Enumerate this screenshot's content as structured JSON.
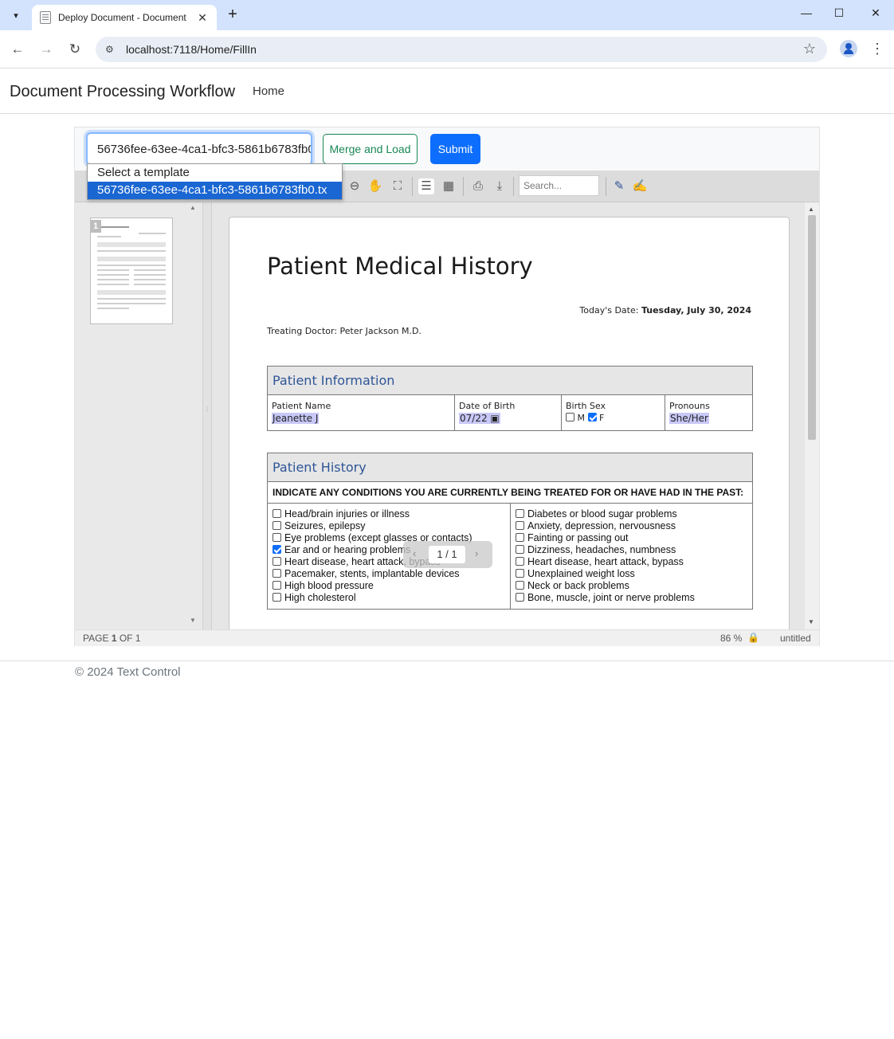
{
  "browser": {
    "tab_title": "Deploy Document - Document",
    "url": "localhost:7118/Home/FillIn"
  },
  "app": {
    "brand": "Document Processing Workflow",
    "nav_home": "Home",
    "footer": "© 2024 Text Control"
  },
  "controls": {
    "template_value": "56736fee-63ee-4ca1-bfc3-5861b6783fb0.tx",
    "merge_label": "Merge and Load",
    "submit_label": "Submit",
    "dropdown_options": [
      "Select a template",
      "56736fee-63ee-4ca1-bfc3-5861b6783fb0.tx"
    ]
  },
  "editor_toolbar": {
    "search_placeholder": "Search..."
  },
  "thumbnail": {
    "page_number": "1"
  },
  "status": {
    "page_prefix": "PAGE",
    "page_current": "1",
    "page_of": "OF 1",
    "zoom": "86 %",
    "doc_name": "untitled"
  },
  "pager": {
    "value": "1 / 1"
  },
  "document": {
    "title": "Patient Medical History",
    "date_label": "Today's Date:",
    "date_value": "Tuesday, July 30, 2024",
    "doctor": "Treating Doctor: Peter Jackson M.D.",
    "patient_info": {
      "heading": "Patient Information",
      "name_label": "Patient Name",
      "name_value": "Jeanette J",
      "dob_label": "Date of Birth",
      "dob_value": "07/22",
      "sex_label": "Birth Sex",
      "sex_m": "M",
      "sex_f": "F",
      "pronouns_label": "Pronouns",
      "pronouns_value": "She/Her"
    },
    "patient_history": {
      "heading": "Patient History",
      "prompt": "INDICATE ANY CONDITIONS YOU ARE CURRENTLY BEING TREATED FOR OR HAVE HAD IN THE PAST:",
      "left": [
        {
          "label": "Head/brain injuries or illness",
          "checked": false
        },
        {
          "label": "Seizures, epilepsy",
          "checked": false
        },
        {
          "label": "Eye problems (except glasses or contacts)",
          "checked": false
        },
        {
          "label": "Ear and or hearing problems",
          "checked": true
        },
        {
          "label": "Heart disease, heart attack, bypass",
          "checked": false
        },
        {
          "label": "Pacemaker, stents, implantable devices",
          "checked": false
        },
        {
          "label": "High blood pressure",
          "checked": false
        },
        {
          "label": "High cholesterol",
          "checked": false
        }
      ],
      "right": [
        {
          "label": "Diabetes or blood sugar problems",
          "checked": false
        },
        {
          "label": "Anxiety, depression, nervousness",
          "checked": false
        },
        {
          "label": "Fainting or passing out",
          "checked": false
        },
        {
          "label": "Dizziness, headaches, numbness",
          "checked": false
        },
        {
          "label": "Heart disease, heart attack, bypass",
          "checked": false
        },
        {
          "label": "Unexplained weight loss",
          "checked": false
        },
        {
          "label": "Neck or back problems",
          "checked": false
        },
        {
          "label": "Bone, muscle, joint or nerve problems",
          "checked": false
        }
      ]
    }
  }
}
